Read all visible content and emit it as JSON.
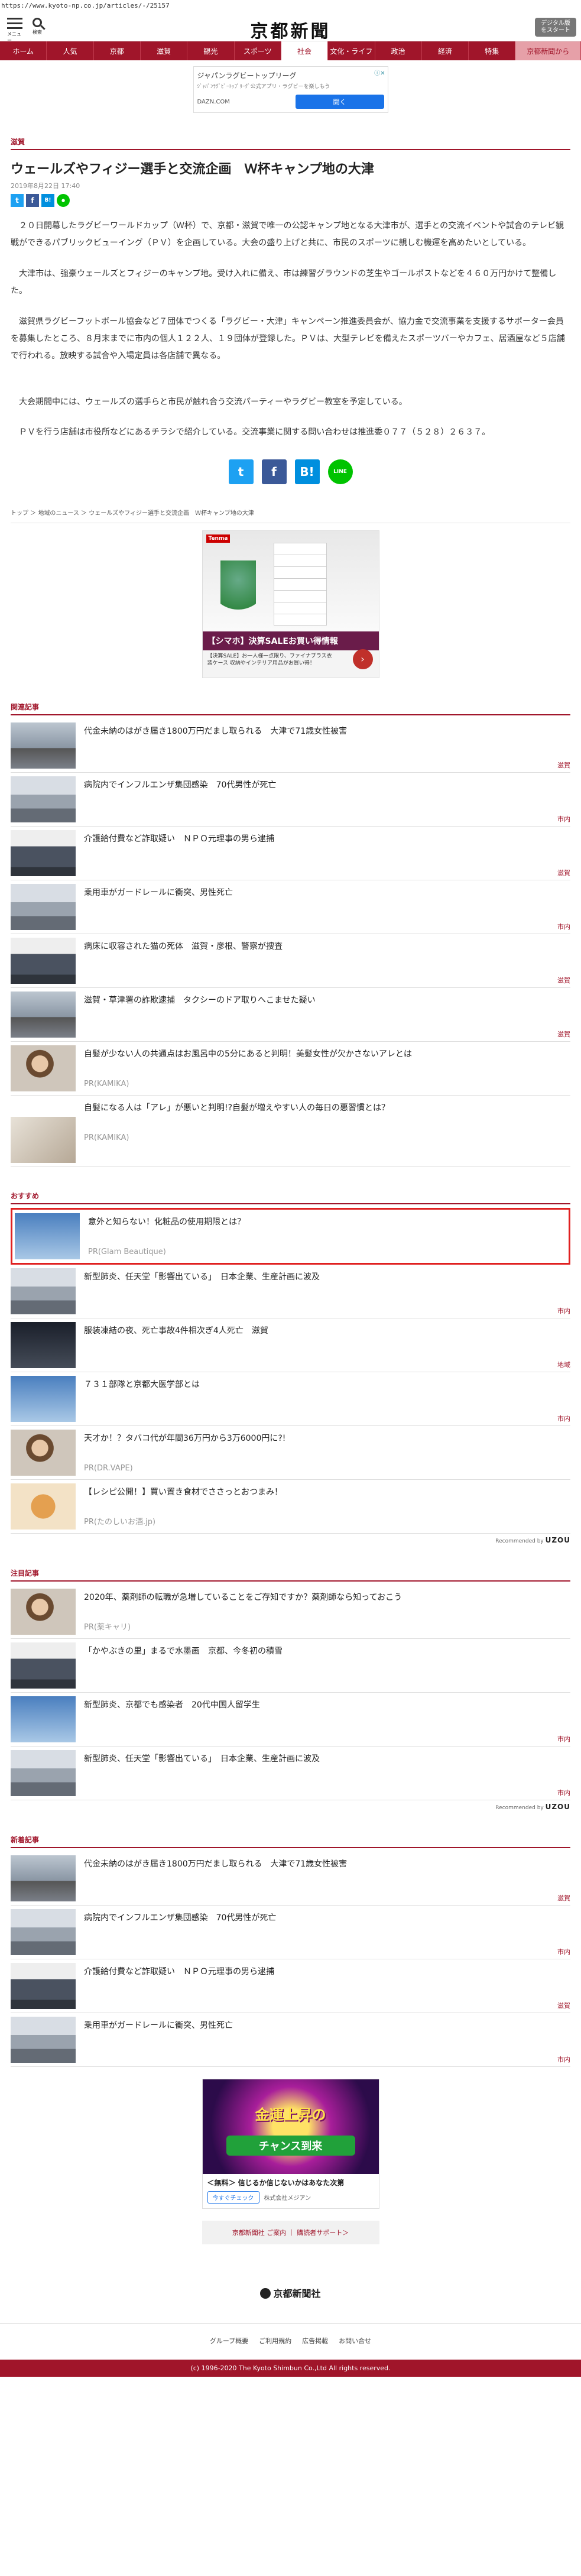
{
  "url": "https://www.kyoto-np.co.jp/articles/-/25157",
  "header": {
    "menu_label": "メニュー",
    "search_label": "検索",
    "logo": "京都新聞",
    "digital_button": "デジタル版をスタート"
  },
  "nav": [
    "ホーム",
    "人気",
    "京都",
    "滋賀",
    "観光",
    "スポーツ",
    "社会",
    "文化・ライフ",
    "政治",
    "経済",
    "特集",
    "京都新聞から"
  ],
  "top_ad": {
    "title": "ジャパンラグビートップリーグ",
    "sub": "ｼﾞｬﾊﾟﾝﾗｸﾞﾋﾞｰﾄｯﾌﾟﾘｰｸﾞ公式アプリ・ラグビーを楽しもう",
    "brand": "DAZN.COM",
    "button": "開く",
    "close": "ⓘ✕"
  },
  "article": {
    "category": "滋賀",
    "title": "ウェールズやフィジー選手と交流企画　Ｗ杯キャンプ地の大津",
    "date": "2019年8月22日 17:40",
    "paragraphs": [
      "２０日開幕したラグビーワールドカップ（Ｗ杯）で、京都・滋賀で唯一の公認キャンプ地となる大津市が、選手との交流イベントや試合のテレビ観戦ができるパブリックビューイング（ＰＶ）を企画している。大会の盛り上げと共に、市民のスポーツに親しむ機運を高めたいとしている。",
      "大津市は、強豪ウェールズとフィジーのキャンプ地。受け入れに備え、市は練習グラウンドの芝生やゴールポストなどを４６０万円かけて整備した。",
      "滋賀県ラグビーフットボール協会など７団体でつくる「ラグビー・大津」キャンペーン推進委員会が、協力金で交流事業を支援するサポーター会員を募集したところ、８月末までに市内の個人１２２人、１９団体が登録した。ＰＶは、大型テレビを備えたスポーツバーやカフェ、居酒屋など５店舗で行われる。放映する試合や入場定員は各店舗で異なる。",
      "大会期間中には、ウェールズの選手らと市民が触れ合う交流パーティーやラグビー教室を予定している。",
      "ＰＶを行う店舗は市役所などにあるチラシで紹介している。交流事業に関する問い合わせは推進委０７７（５２８）２６３７。"
    ]
  },
  "share": {
    "twitter": "t",
    "facebook": "f",
    "hatena": "B!",
    "line": "LINE"
  },
  "breadcrumb": [
    "トップ",
    "地域のニュース",
    "ウェールズやフィジー選手と交流企画　Ｗ杯キャンプ地の大津"
  ],
  "rect_ad": {
    "brand": "Tenma",
    "headline": "【シマホ】決算SALEお買い得情報",
    "sub": "【決算SALE】お一人様一点限り、ファイナプラス衣装ケース 収納やインテリア用品がお買い得！"
  },
  "related": {
    "title": "関連記事",
    "items": [
      {
        "text": "代金未納のはがき届き1800万円だまし取られる　大津で71歳女性被害",
        "tag": "滋賀"
      },
      {
        "text": "病院内でインフルエンザ集団感染　70代男性が死亡",
        "tag": "市内"
      },
      {
        "text": "介護給付費など詐取疑い　ＮＰＯ元理事の男ら逮捕",
        "tag": "滋賀"
      },
      {
        "text": "乗用車がガードレールに衝突、男性死亡",
        "tag": "市内"
      },
      {
        "text": "病床に収容された猫の死体　滋賀・彦根、警察が捜査",
        "tag": "滋賀"
      },
      {
        "text": "滋賀・草津署の詐欺逮捕　タクシーのドア取りへこませた疑い",
        "tag": "滋賀"
      },
      {
        "text": "自髪が少ない人の共通点はお風呂中の5分にあると判明！美髪女性が欠かさないアレとは",
        "pr": "PR(KAMIKA)"
      },
      {
        "text": "自髪になる人は「アレ」が悪いと判明!?自髪が増えやすい人の毎日の悪習慣とは？",
        "pr": "PR(KAMIKA)"
      }
    ]
  },
  "recommend": {
    "title": "おすすめ",
    "items": [
      {
        "text": "意外と知らない！化粧品の使用期限とは？",
        "pr": "PR(Glam Beautique)",
        "highlight": true
      },
      {
        "text": "新型肺炎、任天堂「影響出ている」　日本企業、生産計画に波及",
        "tag": "市内"
      },
      {
        "text": "服装凍結の夜、死亡事故4件相次ぎ4人死亡　滋賀",
        "tag": "地域"
      },
      {
        "text": "７３１部隊と京都大医学部とは",
        "tag": "市内"
      },
      {
        "text": "天才か！？タバコ代が年間36万円から3万6000円に?!",
        "pr": "PR(DR.VAPE)"
      },
      {
        "text": "【レシピ公開！】買い置き食材でささっとおつまみ！",
        "pr": "PR(たのしいお酒.jp)"
      }
    ],
    "provider": "Recommended by",
    "provider_brand": "UZOU"
  },
  "popular": {
    "title": "注目記事",
    "items": [
      {
        "text": "2020年、薬剤師の転職が急増していることをご存知ですか？薬剤師なら知っておこう",
        "pr": "PR(薬キャリ)"
      },
      {
        "text": "「かやぶきの里」まるで水墨画　京都、今冬初の積雪",
        "tag": ""
      },
      {
        "text": "新型肺炎、京都でも感染者　20代中国人留学生",
        "tag": "市内"
      },
      {
        "text": "新型肺炎、任天堂「影響出ている」　日本企業、生産計画に波及",
        "tag": "市内"
      }
    ],
    "provider": "Recommended by",
    "provider_brand": "UZOU"
  },
  "latest": {
    "title": "新着記事",
    "items": [
      {
        "text": "代金未納のはがき届き1800万円だまし取られる　大津で71歳女性被害",
        "tag": "滋賀"
      },
      {
        "text": "病院内でインフルエンザ集団感染　70代男性が死亡",
        "tag": "市内"
      },
      {
        "text": "介護給付費など詐取疑い　ＮＰＯ元理事の男ら逮捕",
        "tag": "滋賀"
      },
      {
        "text": "乗用車がガードレールに衝突、男性死亡",
        "tag": "市内"
      }
    ]
  },
  "game_ad": {
    "title": "金運上昇の",
    "mid": "チャンス到来",
    "caption": "＜無料＞ 信じるか信じないかはあなた次第",
    "button": "今すぐチェック",
    "by": "株式会社メジアン"
  },
  "footer": {
    "links": "京都新聞社 ご案内 ｜ 購読者サポート＞",
    "logo": "京都新聞社",
    "nav": [
      "グループ概要",
      "ご利用規約",
      "広告掲載",
      "お問い合せ"
    ],
    "copyright": "(c) 1996-2020 The Kyoto Shimbun Co.,Ltd All rights reserved."
  }
}
